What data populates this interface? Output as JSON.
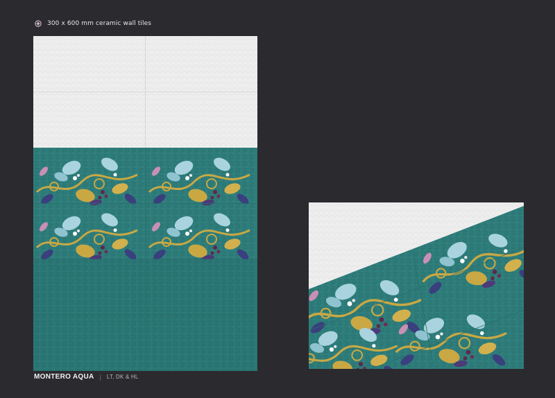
{
  "header": {
    "caption": "300 x 600 mm ceramic wall tiles",
    "icon": "tile-icon"
  },
  "footer": {
    "collection_name": "MONTERO AQUA",
    "separator": "|",
    "variants": "LT, DK & HL"
  },
  "colors": {
    "background": "#2b2a2e",
    "light_tile": "#efefef",
    "aqua_tile": "#2f7f7d",
    "leaf_blue": "#a9d4df",
    "leaf_gold": "#c9a844",
    "leaf_navy": "#3a3f7e",
    "berry_plum": "#5b2a4c"
  },
  "wall_layout": {
    "rows": [
      "LT",
      "LT",
      "HL",
      "HL",
      "DK",
      "DK"
    ],
    "columns": 2
  }
}
